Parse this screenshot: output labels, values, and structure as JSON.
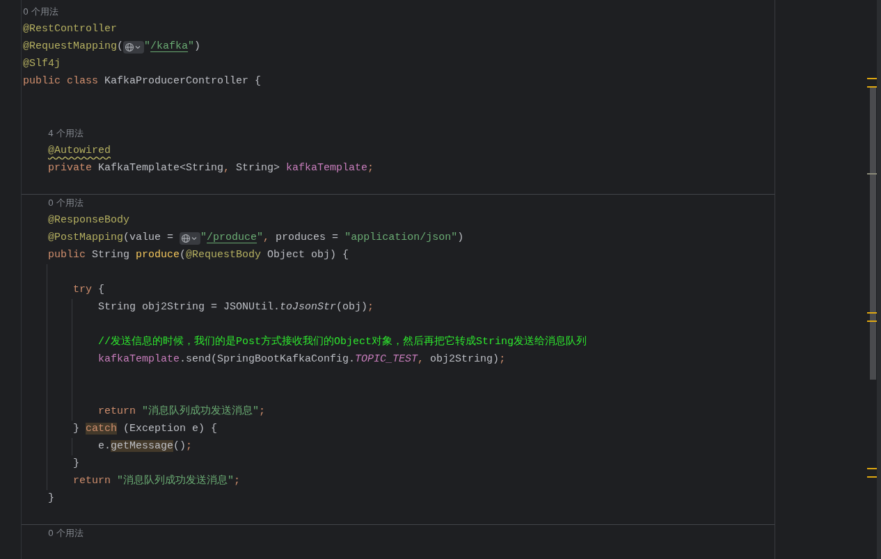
{
  "editor": {
    "lines": [
      {
        "kind": "usages",
        "text": "0 个用法",
        "separated": false
      },
      {
        "kind": "code",
        "segments": [
          {
            "kind": "annotation",
            "text": "@RestController"
          }
        ]
      },
      {
        "kind": "code",
        "segments": [
          {
            "kind": "annotation",
            "text": "@RequestMapping"
          },
          {
            "kind": "plain",
            "text": "("
          },
          {
            "kind": "globe"
          },
          {
            "kind": "string",
            "text": "\""
          },
          {
            "kind": "link",
            "text": "/kafka"
          },
          {
            "kind": "string",
            "text": "\""
          },
          {
            "kind": "plain",
            "text": ")"
          }
        ]
      },
      {
        "kind": "code",
        "segments": [
          {
            "kind": "annotation",
            "text": "@Slf4j"
          }
        ]
      },
      {
        "kind": "code",
        "segments": [
          {
            "kind": "keyword",
            "text": "public "
          },
          {
            "kind": "keyword",
            "text": "class "
          },
          {
            "kind": "plain",
            "text": "KafkaProducerController {"
          }
        ],
        "children": [
          {
            "kind": "blank"
          },
          {
            "kind": "blank"
          },
          {
            "kind": "usages",
            "text": "4 个用法",
            "separated": false
          },
          {
            "kind": "code",
            "segments": [
              {
                "kind": "annotation-warning",
                "text": "@Autowired"
              }
            ]
          },
          {
            "kind": "code",
            "segments": [
              {
                "kind": "keyword",
                "text": "private "
              },
              {
                "kind": "plain",
                "text": "KafkaTemplate<String"
              },
              {
                "kind": "punct",
                "text": ", "
              },
              {
                "kind": "plain",
                "text": "String> "
              },
              {
                "kind": "field",
                "text": "kafkaTemplate"
              },
              {
                "kind": "punct",
                "text": ";"
              }
            ]
          },
          {
            "kind": "blank"
          },
          {
            "kind": "usages",
            "text": "0 个用法",
            "separated": true
          },
          {
            "kind": "code",
            "segments": [
              {
                "kind": "annotation",
                "text": "@ResponseBody"
              }
            ]
          },
          {
            "kind": "code",
            "segments": [
              {
                "kind": "annotation",
                "text": "@PostMapping"
              },
              {
                "kind": "plain",
                "text": "(value = "
              },
              {
                "kind": "globe"
              },
              {
                "kind": "string",
                "text": "\""
              },
              {
                "kind": "link",
                "text": "/produce"
              },
              {
                "kind": "string",
                "text": "\""
              },
              {
                "kind": "punct",
                "text": ", "
              },
              {
                "kind": "plain",
                "text": "produces = "
              },
              {
                "kind": "string",
                "text": "\"application/json\""
              },
              {
                "kind": "plain",
                "text": ")"
              }
            ]
          },
          {
            "kind": "code",
            "segments": [
              {
                "kind": "keyword",
                "text": "public "
              },
              {
                "kind": "plain",
                "text": "String "
              },
              {
                "kind": "method",
                "text": "produce"
              },
              {
                "kind": "plain",
                "text": "("
              },
              {
                "kind": "annotation",
                "text": "@RequestBody"
              },
              {
                "kind": "plain",
                "text": " Object obj) {"
              }
            ],
            "children": [
              {
                "kind": "blank"
              },
              {
                "kind": "code",
                "segments": [
                  {
                    "kind": "keyword",
                    "text": "try "
                  },
                  {
                    "kind": "plain",
                    "text": "{"
                  }
                ],
                "children": [
                  {
                    "kind": "code",
                    "segments": [
                      {
                        "kind": "plain",
                        "text": "String obj2String = JSONUtil."
                      },
                      {
                        "kind": "static",
                        "text": "toJsonStr"
                      },
                      {
                        "kind": "plain",
                        "text": "(obj)"
                      },
                      {
                        "kind": "punct",
                        "text": ";"
                      }
                    ]
                  },
                  {
                    "kind": "blank"
                  },
                  {
                    "kind": "code",
                    "segments": [
                      {
                        "kind": "comment",
                        "text": "//发送信息的时候，我们的是Post方式接收我们的Object对象，然后再把它转成String发送给消息队列"
                      }
                    ]
                  },
                  {
                    "kind": "code",
                    "segments": [
                      {
                        "kind": "field",
                        "text": "kafkaTemplate"
                      },
                      {
                        "kind": "plain",
                        "text": ".send(SpringBootKafkaConfig."
                      },
                      {
                        "kind": "constant",
                        "text": "TOPIC_TEST"
                      },
                      {
                        "kind": "punct",
                        "text": ", "
                      },
                      {
                        "kind": "plain",
                        "text": "obj2String)"
                      },
                      {
                        "kind": "punct",
                        "text": ";"
                      }
                    ]
                  },
                  {
                    "kind": "blank"
                  },
                  {
                    "kind": "blank"
                  },
                  {
                    "kind": "code",
                    "segments": [
                      {
                        "kind": "keyword",
                        "text": "return "
                      },
                      {
                        "kind": "string",
                        "text": "\"消息队列成功发送消息\""
                      },
                      {
                        "kind": "punct",
                        "text": ";"
                      }
                    ]
                  }
                ]
              },
              {
                "kind": "code",
                "segments": [
                  {
                    "kind": "plain",
                    "text": "} "
                  },
                  {
                    "kind": "keyword-match",
                    "text": "catch"
                  },
                  {
                    "kind": "plain",
                    "text": " (Exception e) {"
                  }
                ],
                "children": [
                  {
                    "kind": "code",
                    "segments": [
                      {
                        "kind": "plain",
                        "text": "e."
                      },
                      {
                        "kind": "plain-match",
                        "text": "getMessage"
                      },
                      {
                        "kind": "plain",
                        "text": "()"
                      },
                      {
                        "kind": "punct",
                        "text": ";"
                      }
                    ]
                  }
                ]
              },
              {
                "kind": "code",
                "segments": [
                  {
                    "kind": "plain",
                    "text": "}"
                  }
                ]
              },
              {
                "kind": "code",
                "segments": [
                  {
                    "kind": "keyword",
                    "text": "return "
                  },
                  {
                    "kind": "string",
                    "text": "\"消息队列成功发送消息\""
                  },
                  {
                    "kind": "punct",
                    "text": ";"
                  }
                ]
              }
            ]
          },
          {
            "kind": "code",
            "segments": [
              {
                "kind": "plain",
                "text": "}"
              }
            ]
          },
          {
            "kind": "blank"
          },
          {
            "kind": "usages",
            "text": "0 个用法",
            "separated": true
          }
        ]
      }
    ]
  }
}
